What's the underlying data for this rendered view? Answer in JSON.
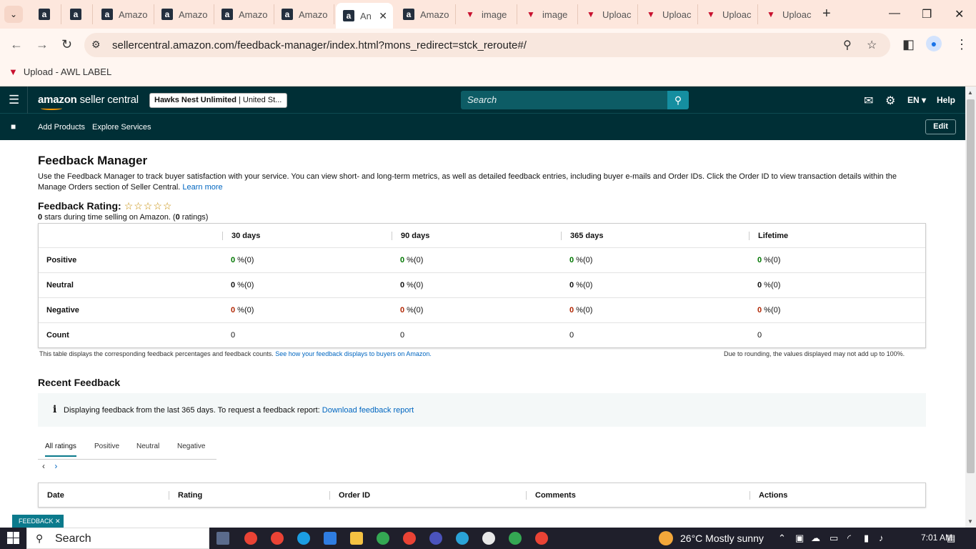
{
  "browser": {
    "tabs": [
      {
        "title": "",
        "icon": "amazon-icon"
      },
      {
        "title": "",
        "icon": "amazon-icon"
      },
      {
        "title": "Amazo",
        "icon": "amazon-icon"
      },
      {
        "title": "Amazo",
        "icon": "amazon-icon"
      },
      {
        "title": "Amazo",
        "icon": "amazon-icon"
      },
      {
        "title": "Amazo",
        "icon": "amazon-icon"
      },
      {
        "title": "An",
        "icon": "amazon-icon",
        "active": true
      },
      {
        "title": "Amazo",
        "icon": "amazon-icon"
      },
      {
        "title": "image",
        "icon": "v-logo-icon"
      },
      {
        "title": "image",
        "icon": "v-logo-icon"
      },
      {
        "title": "Uploac",
        "icon": "v-logo-icon"
      },
      {
        "title": "Uploac",
        "icon": "v-logo-icon"
      },
      {
        "title": "Uploac",
        "icon": "v-logo-icon"
      },
      {
        "title": "Uploac",
        "icon": "v-logo-icon"
      }
    ],
    "url": "sellercentral.amazon.com/feedback-manager/index.html?mons_redirect=stck_reroute#/",
    "bookmark": "Upload - AWL LABEL"
  },
  "header": {
    "logo_main": "amazon",
    "logo_rest": " seller central",
    "store_name": "Hawks Nest Unlimited",
    "store_region": " | United St...",
    "search_placeholder": "Search",
    "lang": "EN",
    "help": "Help",
    "nav": [
      "Add Products",
      "Explore Services"
    ],
    "edit": "Edit"
  },
  "page": {
    "title": "Feedback Manager",
    "intro": "Use the Feedback Manager to track buyer satisfaction with your service. You can view short- and long-term metrics, as well as detailed feedback entries, including buyer e-mails and Order IDs. Click the Order ID to view transaction details within the Manage Orders section of Seller Central. ",
    "learn_more": "Learn more",
    "rating_label": "Feedback Rating:",
    "stars": "☆☆☆☆☆",
    "rating_zero": "0",
    "rating_text1": " stars during time selling on Amazon. (",
    "rating_count": "0",
    "rating_text2": " ratings)",
    "columns": [
      "30 days",
      "90 days",
      "365 days",
      "Lifetime"
    ],
    "rows": [
      {
        "label": "Positive",
        "values": [
          "0",
          "0",
          "0",
          "0"
        ],
        "suffix": " %(0)"
      },
      {
        "label": "Neutral",
        "values": [
          "0",
          "0",
          "0",
          "0"
        ],
        "suffix": " %(0)"
      },
      {
        "label": "Negative",
        "values": [
          "0",
          "0",
          "0",
          "0"
        ],
        "suffix": " %(0)"
      },
      {
        "label": "Count",
        "values": [
          "0",
          "0",
          "0",
          "0"
        ]
      }
    ],
    "note_left": "This table displays the corresponding feedback percentages and feedback counts. ",
    "note_link": "See how your feedback displays to buyers on Amazon.",
    "note_right": "Due to rounding, the values displayed may not add up to 100%.",
    "recent_title": "Recent Feedback",
    "info_text": "Displaying feedback from the last 365 days. To request a feedback report: ",
    "info_link": "Download feedback report",
    "filter_tabs": [
      "All ratings",
      "Positive",
      "Neutral",
      "Negative"
    ],
    "recent_columns": [
      "Date",
      "Rating",
      "Order ID",
      "Comments",
      "Actions"
    ],
    "feedback_tag": "FEEDBACK ✕"
  },
  "taskbar": {
    "search": "Search",
    "temp": "26°C",
    "weather": "Mostly sunny",
    "time": "7:01 AM"
  },
  "colors": {
    "header": "#002f36",
    "accent": "#0b7a8c",
    "positive": "#007600",
    "negative": "#b12704"
  }
}
